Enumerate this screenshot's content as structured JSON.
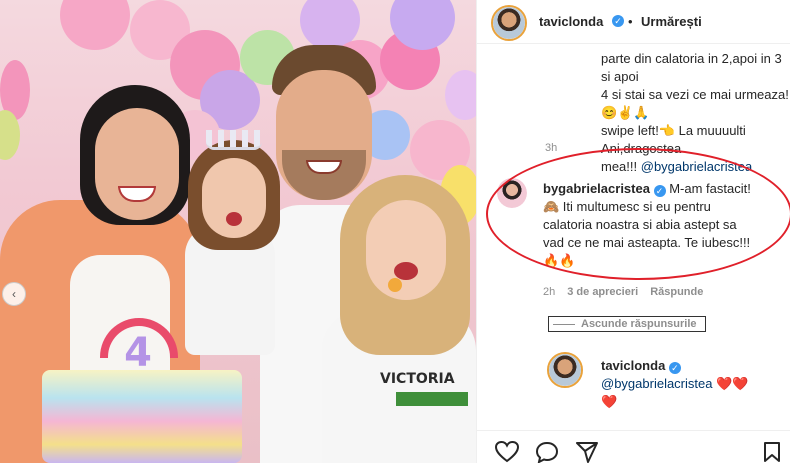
{
  "header": {
    "username": "taviclonda",
    "follow_label": "Urmărești"
  },
  "caption": {
    "line1": "parte din calatoria in 2,apoi in 3 si apoi",
    "line2": "4 si stai sa vezi ce mai urmeaza!😊✌️🙏",
    "line3": "swipe left!👈 La muuuulti Ani,dragostea",
    "line4": "mea!!!",
    "mention": "@bygabrielacristea",
    "time": "3h"
  },
  "comment": {
    "username": "bygabrielacristea",
    "line1": "M-am fastacit!",
    "line2": "🙈 Iti multumesc si eu pentru",
    "line3": "calatoria noastra si abia astept sa",
    "line4": "vad ce ne mai asteapta. Te iubesc!!!",
    "line5": "🔥🔥",
    "time": "2h",
    "likes": "3 de aprecieri",
    "reply_label": "Răspunde"
  },
  "hide_replies_label": "Ascunde răspunsurile",
  "reply": {
    "username": "taviclonda",
    "mention": "@bygabrielacristea",
    "hearts1": "❤️❤️",
    "hearts2": "❤️"
  },
  "cake_number": "4",
  "shirt_text": "VICTORIA",
  "colors": {
    "accent_red": "#e0202a",
    "verified_blue": "#3897f0",
    "mention_blue": "#00376b",
    "muted_gray": "#8e8e8e"
  },
  "icons": [
    "chevron-left-icon",
    "verified-icon",
    "heart-icon",
    "comment-icon",
    "share-icon",
    "bookmark-icon"
  ]
}
